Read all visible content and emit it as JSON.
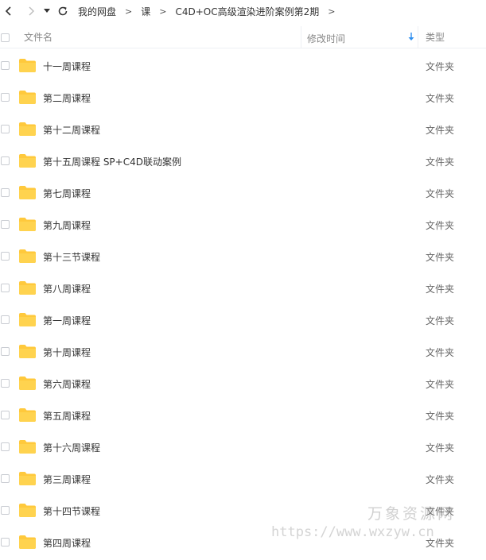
{
  "breadcrumb": {
    "items": [
      "我的网盘",
      "课",
      "C4D+OC高级渲染进阶案例第2期"
    ],
    "separator": ">"
  },
  "columns": {
    "name": "文件名",
    "modified": "修改时间",
    "type": "类型"
  },
  "colors": {
    "folder": "#FFC93C",
    "sort_arrow": "#2F8FEF"
  },
  "files": [
    {
      "name": "十一周课程",
      "type": "文件夹"
    },
    {
      "name": "第二周课程",
      "type": "文件夹"
    },
    {
      "name": "第十二周课程",
      "type": "文件夹"
    },
    {
      "name": "第十五周课程 SP+C4D联动案例",
      "type": "文件夹"
    },
    {
      "name": "第七周课程",
      "type": "文件夹"
    },
    {
      "name": "第九周课程",
      "type": "文件夹"
    },
    {
      "name": "第十三节课程",
      "type": "文件夹"
    },
    {
      "name": "第八周课程",
      "type": "文件夹"
    },
    {
      "name": "第一周课程",
      "type": "文件夹"
    },
    {
      "name": "第十周课程",
      "type": "文件夹"
    },
    {
      "name": "第六周课程",
      "type": "文件夹"
    },
    {
      "name": "第五周课程",
      "type": "文件夹"
    },
    {
      "name": "第十六周课程",
      "type": "文件夹"
    },
    {
      "name": "第三周课程",
      "type": "文件夹"
    },
    {
      "name": "第十四节课程",
      "type": "文件夹"
    },
    {
      "name": "第四周课程",
      "type": "文件夹"
    }
  ],
  "watermark": {
    "title": "万象资源网",
    "url": "https://www.wxzyw.cn"
  }
}
